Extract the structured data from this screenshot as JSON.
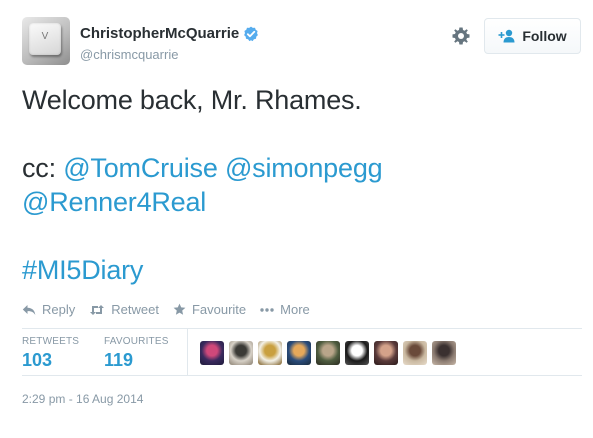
{
  "author": {
    "fullname": "ChristopherMcQuarrie",
    "username": "@chrismcquarrie",
    "avatar_glyph": "V",
    "verified_icon": "verified-badge-icon"
  },
  "header": {
    "follow_label": "Follow",
    "gear_icon": "gear-icon"
  },
  "tweet": {
    "line1": "Welcome back, Mr. Rhames.",
    "cc_prefix": "cc: ",
    "mention1": "@TomCruise",
    "mention2": "@simonpegg",
    "mention3": "@Renner4Real",
    "hashtag": "#MI5Diary"
  },
  "actions": {
    "reply": "Reply",
    "retweet": "Retweet",
    "favourite": "Favourite",
    "more": "More"
  },
  "stats": {
    "retweets_label": "RETWEETS",
    "retweets_count": "103",
    "favourites_label": "FAVOURITES",
    "favourites_count": "119"
  },
  "favouriters": [
    {
      "name": "favouriter-1",
      "colors": [
        "#3a2a5e",
        "#d0487a",
        "#1e1a3a"
      ]
    },
    {
      "name": "favouriter-2",
      "colors": [
        "#d8d2c8",
        "#3b3a36",
        "#8a7f70"
      ]
    },
    {
      "name": "favouriter-3",
      "colors": [
        "#f3f1e8",
        "#c9a040",
        "#7a5a20"
      ]
    },
    {
      "name": "favouriter-4",
      "colors": [
        "#2a4c7c",
        "#e6a85a",
        "#1a2a3a"
      ]
    },
    {
      "name": "favouriter-5",
      "colors": [
        "#4f5d40",
        "#b9a58a",
        "#2a2a20"
      ]
    },
    {
      "name": "favouriter-6",
      "colors": [
        "#1a1a1a",
        "#ffffff",
        "#555555"
      ]
    },
    {
      "name": "favouriter-7",
      "colors": [
        "#5a3a3a",
        "#d4a28a",
        "#2a1a1a"
      ]
    },
    {
      "name": "favouriter-8",
      "colors": [
        "#c9b8a0",
        "#6a4a3a",
        "#e8dccb"
      ]
    },
    {
      "name": "favouriter-9",
      "colors": [
        "#8a7a70",
        "#3a3030",
        "#c8b8a8"
      ]
    }
  ],
  "timestamp": "2:29 pm - 16 Aug 2014",
  "colors": {
    "link": "#2b9ad0",
    "muted": "#8899a6",
    "verified": "#55acee",
    "divider": "#e1e8ed"
  }
}
